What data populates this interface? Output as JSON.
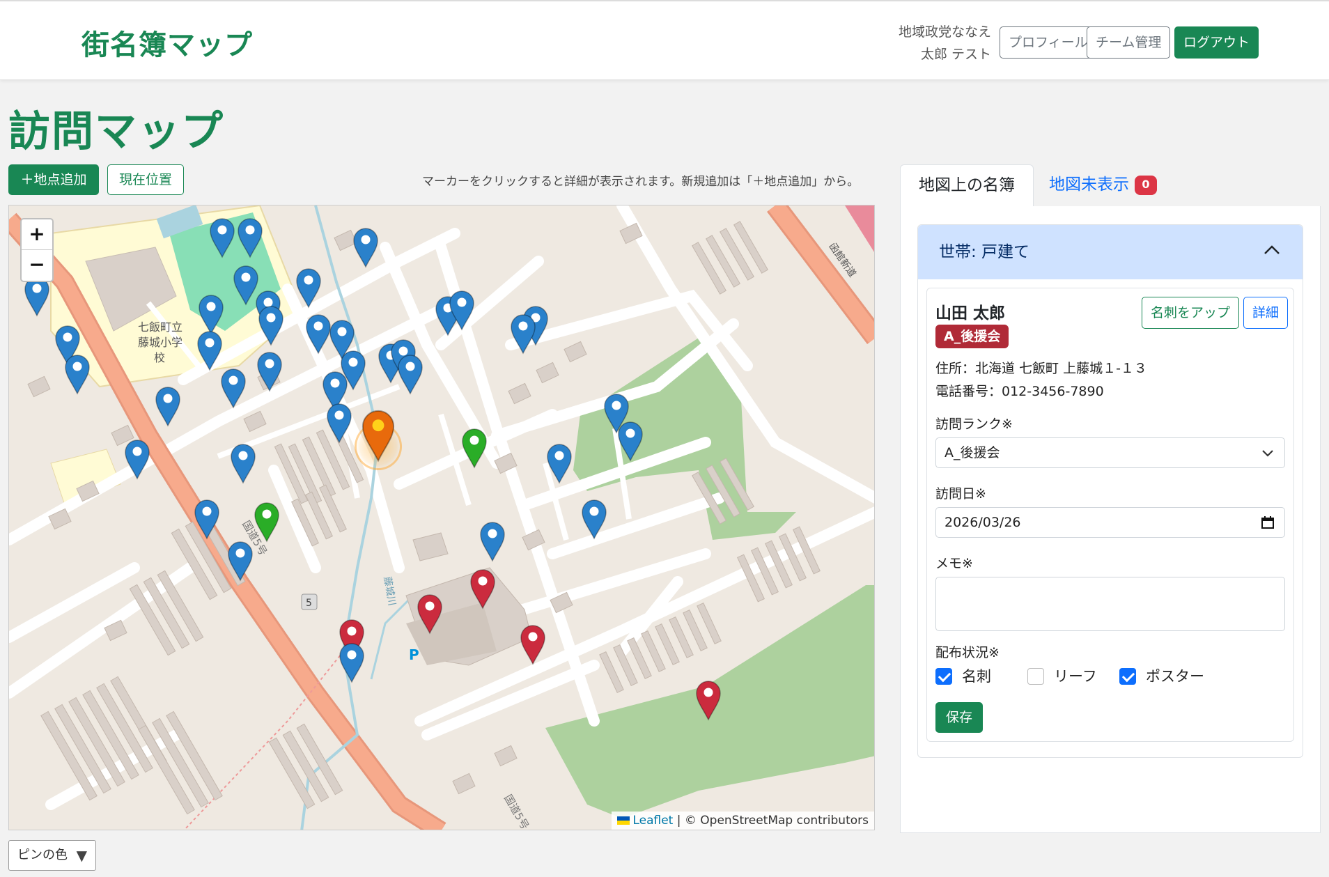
{
  "header": {
    "brand": "街名簿マップ",
    "user_line1": "地域政党ななえ",
    "user_line2": "太郎 テスト",
    "profile_label": "プロフィール",
    "team_label": "チーム管理",
    "logout_label": "ログアウト"
  },
  "page": {
    "title": "訪問マップ"
  },
  "toolbar": {
    "add_label": "＋地点追加",
    "location_label": "現在位置",
    "hint": "マーカーをクリックすると詳細が表示されます。新規追加は「＋地点追加」から。"
  },
  "map": {
    "zoom_in": "+",
    "zoom_out": "−",
    "labels": {
      "school": [
        "七飯町立",
        "藤城小学",
        "校"
      ],
      "road1": "国道5号",
      "road2": "国道5号",
      "river": "藤城川",
      "hakodate": "函館新道",
      "shield": "5",
      "parking": "P"
    },
    "attribution_leaflet": "Leaflet",
    "attribution_rest": " | © OpenStreetMap contributors",
    "pin_colors": {
      "blue": "#2a81cb",
      "green": "#2aad27",
      "red": "#cb2b3e",
      "orange": "#e86a0c"
    }
  },
  "pin_color_dropdown": {
    "label": "ピンの色",
    "arrow": "▼"
  },
  "sidebar": {
    "tab_on_map": "地図上の名簿",
    "tab_hidden": "地図未表示",
    "hidden_count": "0",
    "accordion_title": "世帯: 戸建て",
    "card": {
      "name": "山田 太郎",
      "rank_badge": "A_後援会",
      "btn_card_up": "名刺をアップ",
      "btn_detail": "詳細",
      "address": "住所：北海道 七飯町 上藤城１-１３",
      "phone": "電話番号：012-3456-7890",
      "rank_label": "訪問ランク※",
      "rank_value": "A_後援会",
      "date_label": "訪問日※",
      "date_value": "2026/03/26",
      "memo_label": "メモ※",
      "dist_label": "配布状況※",
      "dist_options": [
        {
          "label": "名刺",
          "checked": true
        },
        {
          "label": "リーフ",
          "checked": false
        },
        {
          "label": "ポスター",
          "checked": true
        }
      ],
      "save_label": "保存"
    }
  }
}
